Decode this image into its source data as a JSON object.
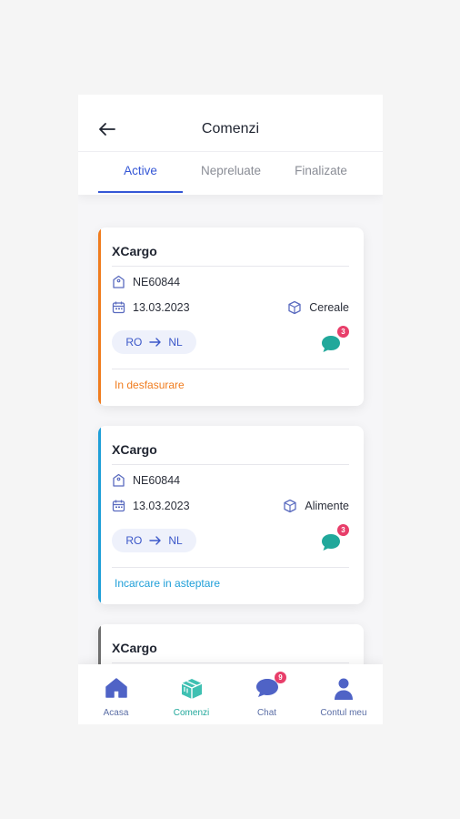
{
  "header": {
    "title": "Comenzi",
    "tabs": [
      {
        "label": "Active",
        "active": true
      },
      {
        "label": "Nepreluate",
        "active": false
      },
      {
        "label": "Finalizate",
        "active": false
      }
    ]
  },
  "orders": [
    {
      "company": "XCargo",
      "order_number": "NE60844",
      "date": "13.03.2023",
      "cargo_type": "Cereale",
      "route_from": "RO",
      "route_to": "NL",
      "unread_messages": "3",
      "status": "In desfasurare",
      "status_color": "#f07c1e"
    },
    {
      "company": "XCargo",
      "order_number": "NE60844",
      "date": "13.03.2023",
      "cargo_type": "Alimente",
      "route_from": "RO",
      "route_to": "NL",
      "unread_messages": "3",
      "status": "Incarcare in asteptare",
      "status_color": "#1f9fd8"
    },
    {
      "company": "XCargo",
      "status_color": "#6f6f6f"
    }
  ],
  "bottom_nav": {
    "items": [
      {
        "label": "Acasa",
        "icon": "home-icon",
        "active": false
      },
      {
        "label": "Comenzi",
        "icon": "box-icon",
        "active": true
      },
      {
        "label": "Chat",
        "icon": "chat-icon",
        "active": false,
        "badge": "9"
      },
      {
        "label": "Contul meu",
        "icon": "user-icon",
        "active": false
      }
    ]
  },
  "colors": {
    "primary": "#3557d6",
    "teal": "#21a89b",
    "badge": "#e83e6a",
    "nav_icon": "#4f63c6"
  }
}
